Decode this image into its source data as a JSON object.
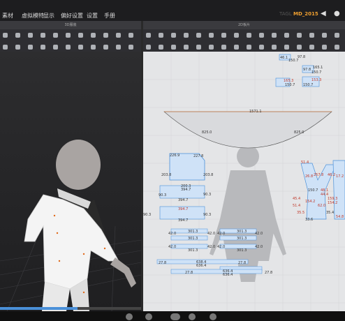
{
  "menu": {
    "items": [
      "素材",
      "虚拟模特",
      "显示",
      "偏好设置",
      "设置",
      "手册"
    ],
    "brand_prefix": "TAGL",
    "brand": "MD_2015"
  },
  "viewports": {
    "left_title": "3D服装",
    "right_title": "2D板片"
  },
  "pattern_labels": {
    "top_right": [
      "46.1",
      "97.8",
      "150.7",
      "97.8",
      "165.1",
      "150.7",
      "165.3",
      "150.7",
      "153.3",
      "150.7"
    ],
    "arc": [
      "1571.1",
      "825.0",
      "825.0"
    ],
    "sleeve": [
      "226.9",
      "227.8",
      "203.8",
      "203.8"
    ],
    "body_mid": [
      "200.3",
      "394.7",
      "90.3",
      "90.3",
      "394.7"
    ],
    "body_low": [
      "394.7",
      "90.3",
      "394.7",
      "90.3"
    ],
    "strips": [
      "301.3",
      "301.3",
      "42.0",
      "42.0",
      "42.0",
      "42.0",
      "301.3",
      "301.3",
      "42.0",
      "42.0",
      "42.0",
      "42.0",
      "301.3",
      "301.3"
    ],
    "bottom": [
      "27.8",
      "27.8",
      "638.4",
      "636.4",
      "27.8",
      "27.8",
      "636.4",
      "636.4"
    ],
    "right_shapes": [
      "51.4",
      "26.8",
      "257.8",
      "46.2",
      "17.2",
      "150.7",
      "48.1",
      "44.4",
      "45.4",
      "154.2",
      "159.3",
      "154.2",
      "51.4",
      "62.0",
      "35.5",
      "33.6",
      "35.4",
      "54.8"
    ]
  },
  "playback": {
    "progress": 0.55
  }
}
